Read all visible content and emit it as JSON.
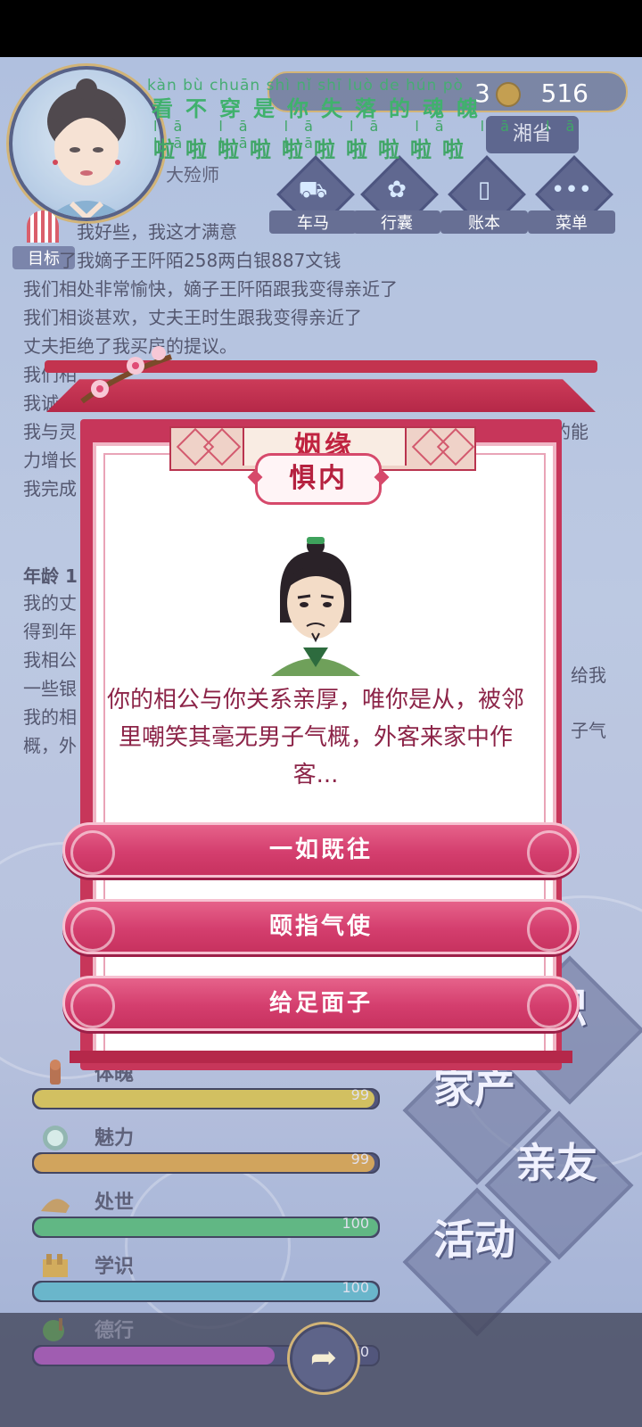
{
  "hud": {
    "player_name": "大殓师",
    "coins": "516",
    "coins_partial": "3",
    "region": "湘省",
    "actions": [
      {
        "label": "车马",
        "icon": "carriage-icon"
      },
      {
        "label": "行囊",
        "icon": "bundle-icon"
      },
      {
        "label": "账本",
        "icon": "ledger-icon"
      },
      {
        "label": "菜单",
        "icon": "menu-dots-icon"
      }
    ]
  },
  "pinyin_overlay": {
    "pinyin": "kàn bù chuān shì nǐ shī luò de hún pò",
    "hanzi": "看不穿是你失落的魂魄",
    "la_pinyin": "lā lā lā lā lā lā lā lā lā lā",
    "la_hanzi": "啦啦啦啦啦啦啦啦啦啦"
  },
  "goal_label": "目标",
  "log_lines": [
    "我好些，我这才满意",
    "了我嫡子王阡陌258两白银887文钱",
    "我们相处非常愉快，嫡子王阡陌跟我变得亲近了",
    "我们相谈甚欢，丈夫王时生跟我变得亲近了",
    "丈夫拒绝了我买房的提议。",
    "我们相",
    "我诚",
    "我与灵",
    "力增长",
    "我完成"
  ],
  "log_right_fragment": "的能",
  "age_label": "年龄 1",
  "log2_lines": [
    "我的丈",
    "得到年",
    "我相公",
    "一些银",
    "我的相",
    "概，外"
  ],
  "log2_right_fragments": [
    "给我",
    "子气"
  ],
  "stats": [
    {
      "name": "体魄",
      "value": "99",
      "level": 0.99,
      "color": "#c8b23f",
      "icon": "body-icon"
    },
    {
      "name": "魅力",
      "value": "99",
      "level": 0.99,
      "color": "#c7913a",
      "icon": "charm-icon"
    },
    {
      "name": "处世",
      "value": "100",
      "level": 1.0,
      "color": "#3fa86a",
      "icon": "worldly-icon"
    },
    {
      "name": "学识",
      "value": "100",
      "level": 1.0,
      "color": "#4aa6c0",
      "icon": "knowledge-icon"
    },
    {
      "name": "德行",
      "value": "70",
      "level": 0.7,
      "color": "#8c3aa0",
      "icon": "virtue-icon"
    }
  ],
  "tiles": [
    {
      "label": "家产"
    },
    {
      "label": "亲友"
    },
    {
      "label": "活动"
    },
    {
      "label": "职"
    }
  ],
  "modal": {
    "title": "姻缘",
    "subtitle": "惧内",
    "message": "你的相公与你关系亲厚，唯你是从，被邻里嘲笑其毫无男子气概，外客来家中作客...",
    "choices": [
      "一如既往",
      "颐指气使",
      "给足面子"
    ]
  }
}
